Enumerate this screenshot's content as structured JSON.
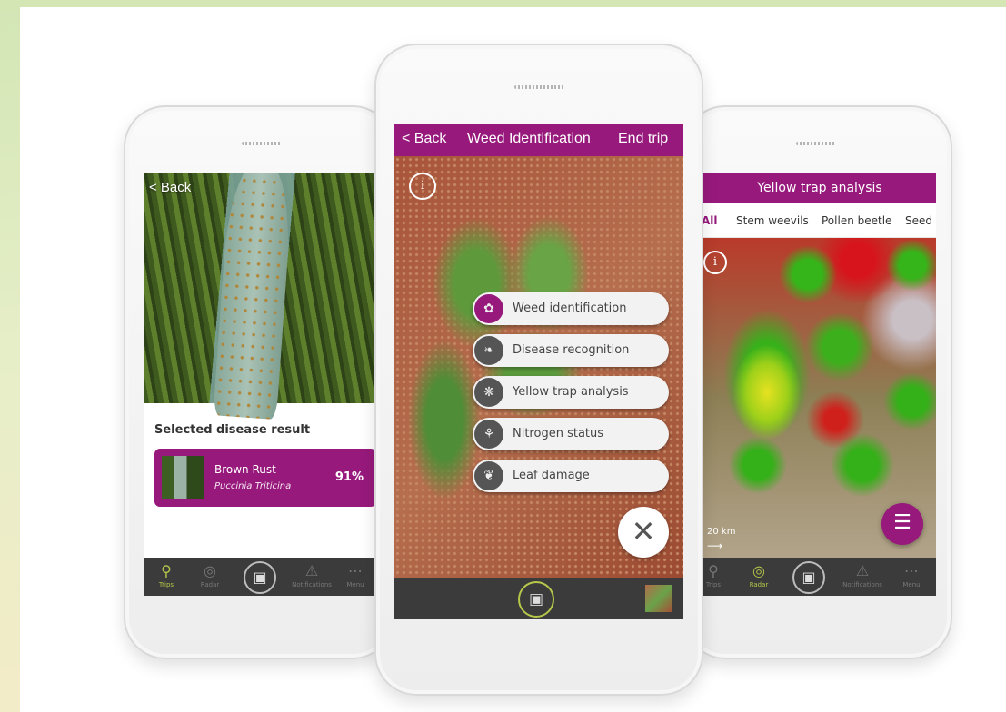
{
  "left_phone": {
    "back_label": "< Back",
    "section_title": "Selected disease result",
    "result": {
      "name": "Brown Rust",
      "latin": "Puccinia Triticina",
      "confidence": "91%"
    },
    "tabs": [
      {
        "label": "Trips",
        "icon": "pin-icon"
      },
      {
        "label": "Radar",
        "icon": "radar-icon"
      },
      {
        "label": "Notifications",
        "icon": "bell-icon"
      },
      {
        "label": "Menu",
        "icon": "dots-icon"
      }
    ]
  },
  "center_phone": {
    "header": {
      "back_label": "< Back",
      "title": "Weed Identification",
      "end_label": "End trip"
    },
    "info_glyph": "i",
    "menu_items": [
      {
        "label": "Weed identification",
        "icon": "sprout-icon"
      },
      {
        "label": "Disease recognition",
        "icon": "leaf-icon"
      },
      {
        "label": "Yellow trap analysis",
        "icon": "insect-icon"
      },
      {
        "label": "Nitrogen status",
        "icon": "plant-icon"
      },
      {
        "label": "Leaf damage",
        "icon": "damaged-leaf-icon"
      }
    ],
    "close_glyph": "✕"
  },
  "right_phone": {
    "header_title": "Yellow trap analysis",
    "filters": [
      "All",
      "Stem weevils",
      "Pollen beetle",
      "Seed"
    ],
    "selected_filter": "All",
    "info_glyph": "i",
    "scale_label": "20 km",
    "tabs": [
      {
        "label": "Trips",
        "icon": "pin-icon"
      },
      {
        "label": "Radar",
        "icon": "radar-icon"
      },
      {
        "label": "Notifications",
        "icon": "bell-icon"
      },
      {
        "label": "Menu",
        "icon": "dots-icon"
      }
    ]
  },
  "colors": {
    "brand_purple": "#97197c",
    "tabbar_dark": "#3b3b3b",
    "accent_green": "#b6c74a"
  }
}
